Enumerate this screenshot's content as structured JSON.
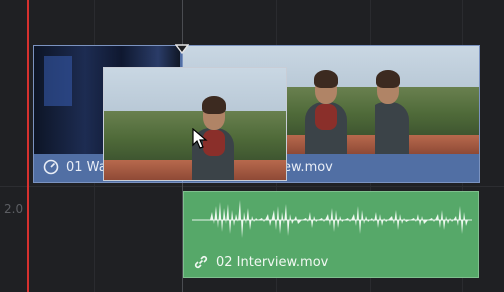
{
  "tracks": {
    "audio_track_label": "2.0"
  },
  "clips": {
    "video_clip_1": {
      "name": "01 Wa",
      "icon": "speed-gauge-icon"
    },
    "video_clip_2": {
      "name": "ew.mov"
    },
    "audio_clip": {
      "name": "02 Interview.mov",
      "icon": "link-icon"
    }
  },
  "colors": {
    "video_clip": "#516fa4",
    "audio_clip": "#56a869",
    "playhead": "#d6312f",
    "background": "#1f2023"
  }
}
